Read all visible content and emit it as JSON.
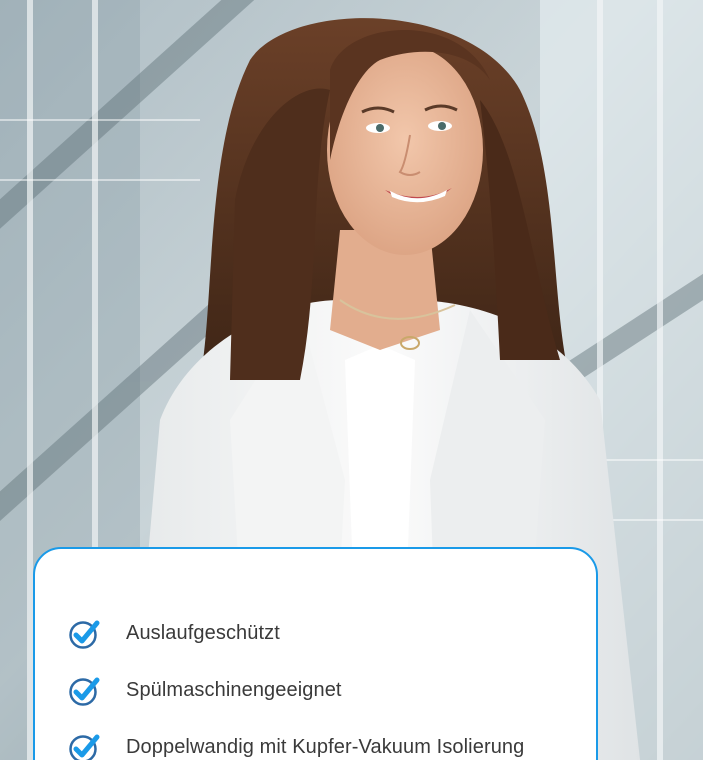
{
  "features": [
    {
      "label": "Auslaufgeschützt",
      "icon": "check-circle-icon"
    },
    {
      "label": "Spülmaschinengeeignet",
      "icon": "check-circle-icon"
    },
    {
      "label": "Doppelwandig mit Kupfer-Vakuum Isolierung",
      "icon": "check-circle-icon"
    }
  ],
  "colors": {
    "accent": "#1a9ae8",
    "text": "#3a3a3a",
    "icon_ring": "#2d6aa6"
  }
}
